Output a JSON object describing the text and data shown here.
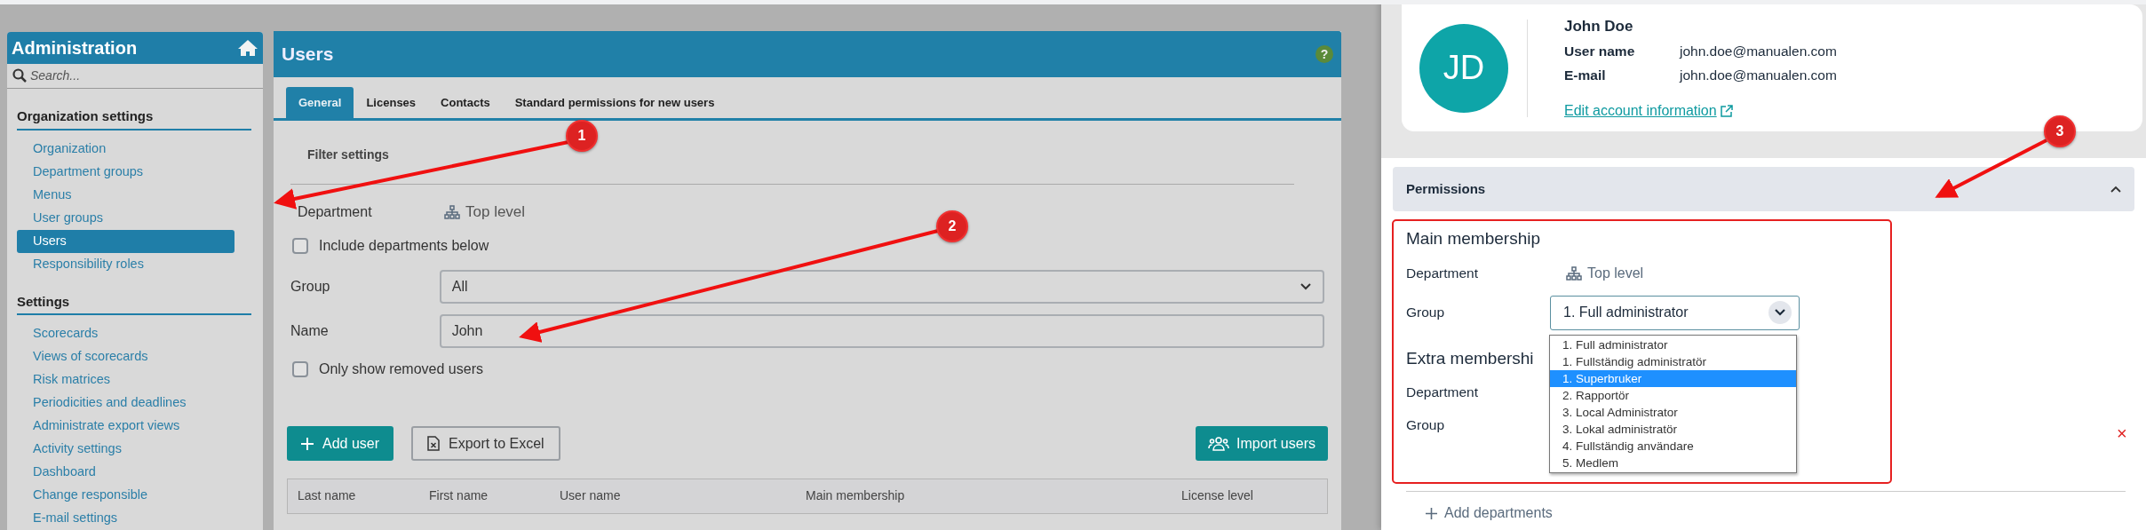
{
  "sidebar": {
    "title": "Administration",
    "search": {
      "placeholder": "Search..."
    },
    "sections": [
      {
        "heading": "Organization settings",
        "items": [
          {
            "label": "Organization",
            "selected": false
          },
          {
            "label": "Department groups",
            "selected": false
          },
          {
            "label": "Menus",
            "selected": false
          },
          {
            "label": "User groups",
            "selected": false
          },
          {
            "label": "Users",
            "selected": true
          },
          {
            "label": "Responsibility roles",
            "selected": false
          }
        ]
      },
      {
        "heading": "Settings",
        "items": [
          {
            "label": "Scorecards",
            "selected": false
          },
          {
            "label": "Views of scorecards",
            "selected": false
          },
          {
            "label": "Risk matrices",
            "selected": false
          },
          {
            "label": "Periodicities and deadlines",
            "selected": false
          },
          {
            "label": "Administrate export views",
            "selected": false
          },
          {
            "label": "Activity settings",
            "selected": false
          },
          {
            "label": "Dashboard",
            "selected": false
          },
          {
            "label": "Change responsible",
            "selected": false
          },
          {
            "label": "E-mail settings",
            "selected": false
          }
        ]
      }
    ]
  },
  "users_panel": {
    "title": "Users",
    "help": "?",
    "tabs": [
      {
        "label": "General",
        "selected": true
      },
      {
        "label": "Licenses",
        "selected": false
      },
      {
        "label": "Contacts",
        "selected": false
      },
      {
        "label": "Standard permissions for new users",
        "selected": false
      }
    ],
    "filter": {
      "heading": "Filter settings",
      "department": {
        "label": "Department",
        "value": "Top level"
      },
      "include_below": {
        "label": "Include departments below",
        "checked": false
      },
      "group": {
        "label": "Group",
        "value": "All"
      },
      "name": {
        "label": "Name",
        "value": "John"
      },
      "only_removed": {
        "label": "Only show removed users",
        "checked": false
      }
    },
    "actions": [
      {
        "label": "Add user",
        "kind": "primary"
      },
      {
        "label": "Export to Excel",
        "kind": "outline"
      }
    ],
    "import_button": {
      "label": "Import users"
    },
    "table": {
      "columns": [
        "Last name",
        "First name",
        "User name",
        "Main membership",
        "License level"
      ]
    }
  },
  "user_details": {
    "initials": "JD",
    "name": "John Doe",
    "fields": [
      {
        "label": "User name",
        "value": "john.doe@manualen.com"
      },
      {
        "label": "E-mail",
        "value": "john.doe@manualen.com"
      }
    ],
    "edit_link": "Edit account information",
    "permissions": {
      "title": "Permissions",
      "expanded": true,
      "main_membership": {
        "heading": "Main membership",
        "department": {
          "label": "Department",
          "value": "Top level"
        },
        "group": {
          "label": "Group",
          "value": "1. Full administrator",
          "options": [
            {
              "label": "1. Full administrator",
              "highlighted": false
            },
            {
              "label": "1. Fullständig administratör",
              "highlighted": false
            },
            {
              "label": "1. Superbruker",
              "highlighted": true
            },
            {
              "label": "2. Rapportör",
              "highlighted": false
            },
            {
              "label": "3. Local Administrator",
              "highlighted": false
            },
            {
              "label": "3. Lokal administratör",
              "highlighted": false
            },
            {
              "label": "4. Fullständig användare",
              "highlighted": false
            },
            {
              "label": "5. Medlem",
              "highlighted": false
            }
          ]
        }
      },
      "extra_membership": {
        "heading": "Extra membershi",
        "department_label": "Department",
        "group_label": "Group",
        "remove": "×"
      },
      "add_departments": "Add departments"
    }
  },
  "annotations": [
    {
      "number": "1"
    },
    {
      "number": "2"
    },
    {
      "number": "3"
    }
  ]
}
